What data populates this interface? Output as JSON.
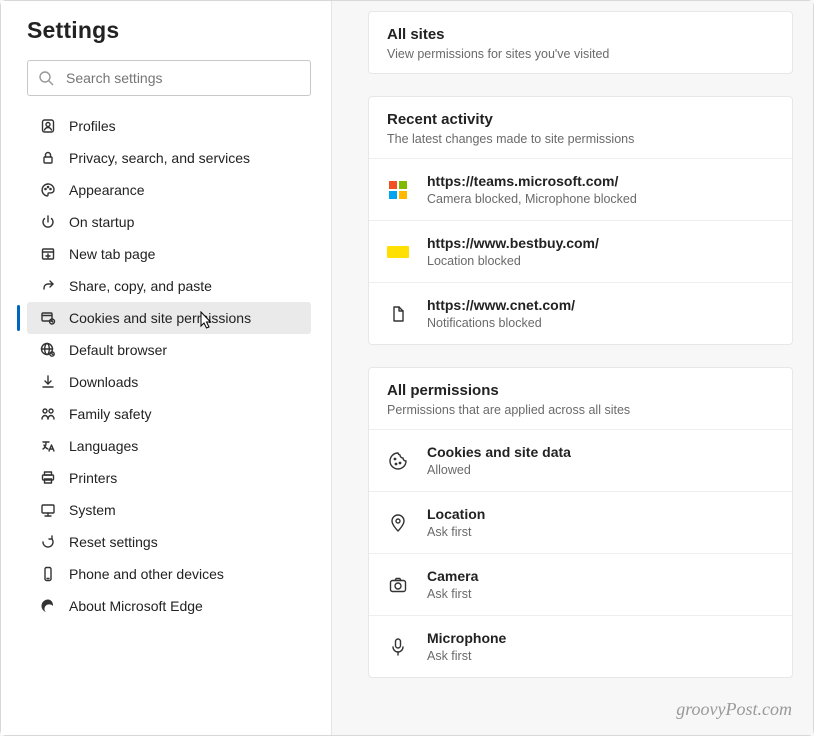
{
  "sidebar": {
    "title": "Settings",
    "search_placeholder": "Search settings",
    "items": [
      {
        "label": "Profiles",
        "icon": "profile-icon",
        "active": false
      },
      {
        "label": "Privacy, search, and services",
        "icon": "lock-icon",
        "active": false
      },
      {
        "label": "Appearance",
        "icon": "palette-icon",
        "active": false
      },
      {
        "label": "On startup",
        "icon": "power-icon",
        "active": false
      },
      {
        "label": "New tab page",
        "icon": "newtab-icon",
        "active": false
      },
      {
        "label": "Share, copy, and paste",
        "icon": "share-icon",
        "active": false
      },
      {
        "label": "Cookies and site permissions",
        "icon": "permissions-icon",
        "active": true
      },
      {
        "label": "Default browser",
        "icon": "browser-icon",
        "active": false
      },
      {
        "label": "Downloads",
        "icon": "download-icon",
        "active": false
      },
      {
        "label": "Family safety",
        "icon": "family-icon",
        "active": false
      },
      {
        "label": "Languages",
        "icon": "language-icon",
        "active": false
      },
      {
        "label": "Printers",
        "icon": "printer-icon",
        "active": false
      },
      {
        "label": "System",
        "icon": "system-icon",
        "active": false
      },
      {
        "label": "Reset settings",
        "icon": "reset-icon",
        "active": false
      },
      {
        "label": "Phone and other devices",
        "icon": "phone-icon",
        "active": false
      },
      {
        "label": "About Microsoft Edge",
        "icon": "edge-icon",
        "active": false
      }
    ]
  },
  "cards": {
    "all_sites": {
      "title": "All sites",
      "sub": "View permissions for sites you've visited"
    },
    "recent": {
      "title": "Recent activity",
      "sub": "The latest changes made to site permissions",
      "items": [
        {
          "icon": "microsoft-logo-icon",
          "title": "https://teams.microsoft.com/",
          "sub": "Camera blocked, Microphone blocked"
        },
        {
          "icon": "bestbuy-logo-icon",
          "title": "https://www.bestbuy.com/",
          "sub": "Location blocked"
        },
        {
          "icon": "page-icon",
          "title": "https://www.cnet.com/",
          "sub": "Notifications blocked"
        }
      ]
    },
    "all_perms": {
      "title": "All permissions",
      "sub": "Permissions that are applied across all sites",
      "items": [
        {
          "icon": "cookie-icon",
          "title": "Cookies and site data",
          "sub": "Allowed"
        },
        {
          "icon": "location-icon",
          "title": "Location",
          "sub": "Ask first"
        },
        {
          "icon": "camera-icon",
          "title": "Camera",
          "sub": "Ask first"
        },
        {
          "icon": "microphone-icon",
          "title": "Microphone",
          "sub": "Ask first"
        }
      ]
    }
  },
  "watermark": "groovyPost.com"
}
